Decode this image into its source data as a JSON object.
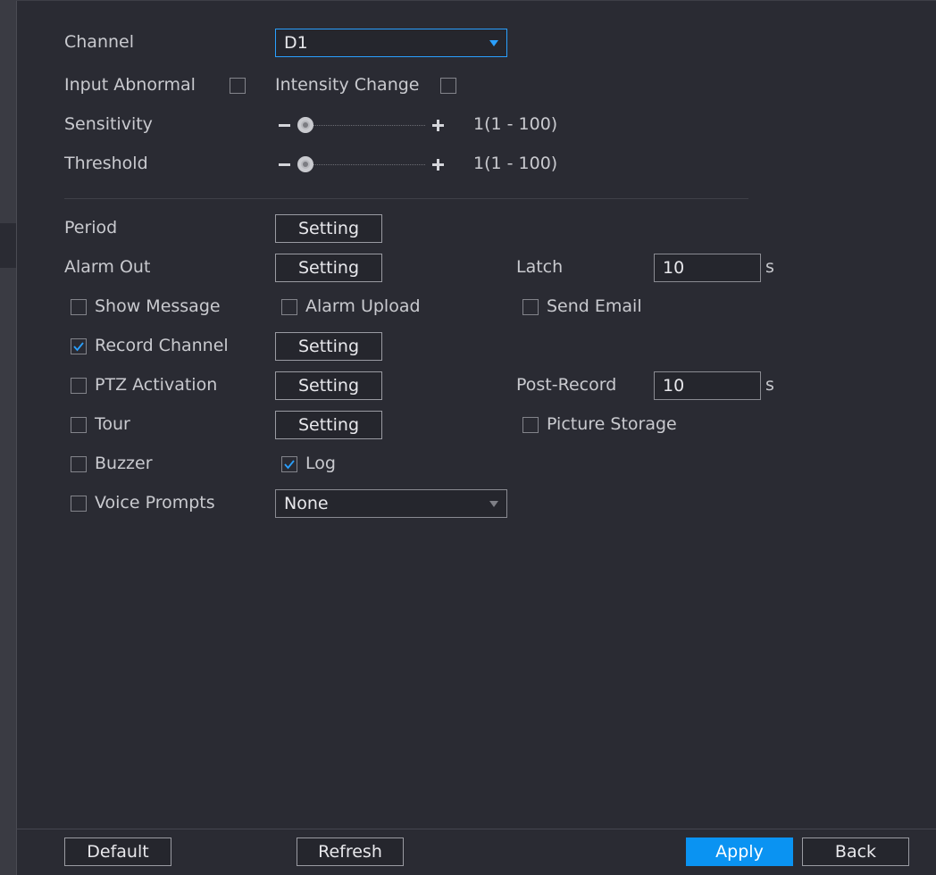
{
  "form": {
    "channel_label": "Channel",
    "channel_value": "D1",
    "input_abnormal_label": "Input Abnormal",
    "intensity_change_label": "Intensity Change",
    "sensitivity_label": "Sensitivity",
    "sensitivity_value": "1(1 - 100)",
    "sensitivity_level": 1,
    "threshold_label": "Threshold",
    "threshold_value": "1(1 - 100)",
    "threshold_level": 1,
    "period_label": "Period",
    "alarm_out_label": "Alarm Out",
    "latch_label": "Latch",
    "latch_value": "10",
    "latch_unit": "s",
    "show_message_label": "Show Message",
    "alarm_upload_label": "Alarm Upload",
    "send_email_label": "Send Email",
    "record_channel_label": "Record Channel",
    "ptz_activation_label": "PTZ Activation",
    "post_record_label": "Post-Record",
    "post_record_value": "10",
    "post_record_unit": "s",
    "tour_label": "Tour",
    "picture_storage_label": "Picture Storage",
    "buzzer_label": "Buzzer",
    "log_label": "Log",
    "voice_prompts_label": "Voice Prompts",
    "voice_prompts_value": "None",
    "setting_label": "Setting"
  },
  "checks": {
    "input_abnormal": false,
    "intensity_change": false,
    "show_message": false,
    "alarm_upload": false,
    "send_email": false,
    "record_channel": true,
    "ptz_activation": false,
    "tour": false,
    "picture_storage": false,
    "buzzer": false,
    "log": true,
    "voice_prompts": false
  },
  "footer": {
    "default_label": "Default",
    "refresh_label": "Refresh",
    "apply_label": "Apply",
    "back_label": "Back"
  },
  "colors": {
    "accent": "#0a93f2",
    "background": "#2a2b33"
  }
}
